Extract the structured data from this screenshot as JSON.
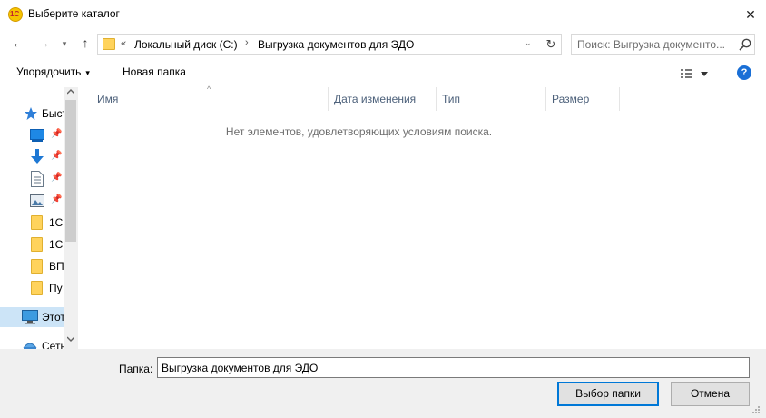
{
  "window": {
    "title": "Выберите каталог",
    "app_icon_text": "1С",
    "close_glyph": "✕"
  },
  "nav": {
    "back_glyph": "←",
    "forward_glyph": "→",
    "recent_glyph": "▾",
    "up_glyph": "↑"
  },
  "address": {
    "chevron": "«",
    "crumbs": [
      "Локальный диск (C:)",
      "Выгрузка документов для ЭДО"
    ],
    "separator": "›",
    "dropdown_glyph": "⌄",
    "refresh_glyph": "↻"
  },
  "search": {
    "placeholder": "Поиск: Выгрузка документо..."
  },
  "toolbar": {
    "organize_label": "Упорядочить",
    "organize_caret": "▾",
    "new_folder_label": "Новая папка",
    "help_label": "?"
  },
  "sidebar": {
    "items": [
      {
        "label": "Быст",
        "icon": "star-icon"
      },
      {
        "label": "",
        "icon": "desktop-icon"
      },
      {
        "label": "",
        "icon": "download-icon"
      },
      {
        "label": "",
        "icon": "document-icon"
      },
      {
        "label": "",
        "icon": "pictures-icon"
      },
      {
        "label": "1С",
        "icon": "folder-icon"
      },
      {
        "label": "1С",
        "icon": "folder-icon"
      },
      {
        "label": "ВП",
        "icon": "folder-icon"
      },
      {
        "label": "Пу",
        "icon": "folder-icon"
      },
      {
        "label": "Этот",
        "icon": "computer-icon"
      },
      {
        "label": "Сеть",
        "icon": "network-icon"
      }
    ],
    "pin_glyph": "📌"
  },
  "file_list": {
    "columns": [
      "Имя",
      "Дата изменения",
      "Тип",
      "Размер"
    ],
    "sort_glyph": "^",
    "empty_message": "Нет элементов, удовлетворяющих условиям поиска."
  },
  "bottom": {
    "folder_label": "Папка:",
    "folder_value": "Выгрузка документов для ЭДО",
    "select_button": "Выбор папки",
    "cancel_button": "Отмена"
  },
  "colors": {
    "accent": "#0078d7",
    "selection": "#cce4f7",
    "header_text": "#4c607a"
  }
}
